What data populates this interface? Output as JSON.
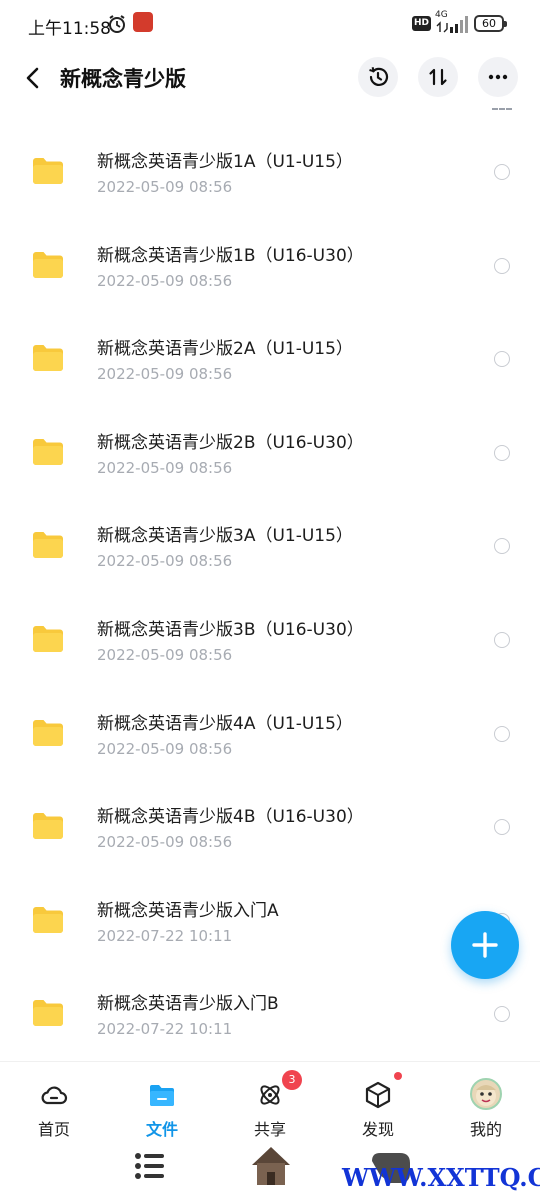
{
  "status_bar": {
    "time": "上午11:58",
    "hd_label": "HD",
    "network": "4G",
    "battery": "60",
    "icons": [
      "alarm-icon",
      "app-notification-icon",
      "signal-icon",
      "battery-icon"
    ]
  },
  "header": {
    "title": "新概念青少版",
    "icons": [
      "back-arrow-icon",
      "history-icon",
      "sort-icon",
      "more-icon"
    ]
  },
  "folders": [
    {
      "name": "新概念英语青少版1A（U1-U15）",
      "date": "2022-05-09  08:56"
    },
    {
      "name": "新概念英语青少版1B（U16-U30）",
      "date": "2022-05-09  08:56"
    },
    {
      "name": "新概念英语青少版2A（U1-U15）",
      "date": "2022-05-09  08:56"
    },
    {
      "name": "新概念英语青少版2B（U16-U30）",
      "date": "2022-05-09  08:56"
    },
    {
      "name": "新概念英语青少版3A（U1-U15）",
      "date": "2022-05-09  08:56"
    },
    {
      "name": "新概念英语青少版3B（U16-U30）",
      "date": "2022-05-09  08:56"
    },
    {
      "name": "新概念英语青少版4A（U1-U15）",
      "date": "2022-05-09  08:56"
    },
    {
      "name": "新概念英语青少版4B（U16-U30）",
      "date": "2022-05-09  08:56"
    },
    {
      "name": "新概念英语青少版入门A",
      "date": "2022-07-22  10:11"
    },
    {
      "name": "新概念英语青少版入门B",
      "date": "2022-07-22  10:11"
    }
  ],
  "bottom_nav": {
    "items": [
      {
        "label": "首页",
        "icon": "home-cloud-icon"
      },
      {
        "label": "文件",
        "icon": "folder-icon",
        "active": true
      },
      {
        "label": "共享",
        "icon": "share-atom-icon",
        "badge": "3"
      },
      {
        "label": "发现",
        "icon": "discover-box-icon",
        "dot": true
      },
      {
        "label": "我的",
        "icon": "avatar"
      }
    ]
  },
  "watermark": "WWW.XXTTQ.COM",
  "colors": {
    "accent": "#1195e8",
    "fab": "#18a6f3",
    "folder": "#fcd34d",
    "badge": "#f0444f"
  }
}
